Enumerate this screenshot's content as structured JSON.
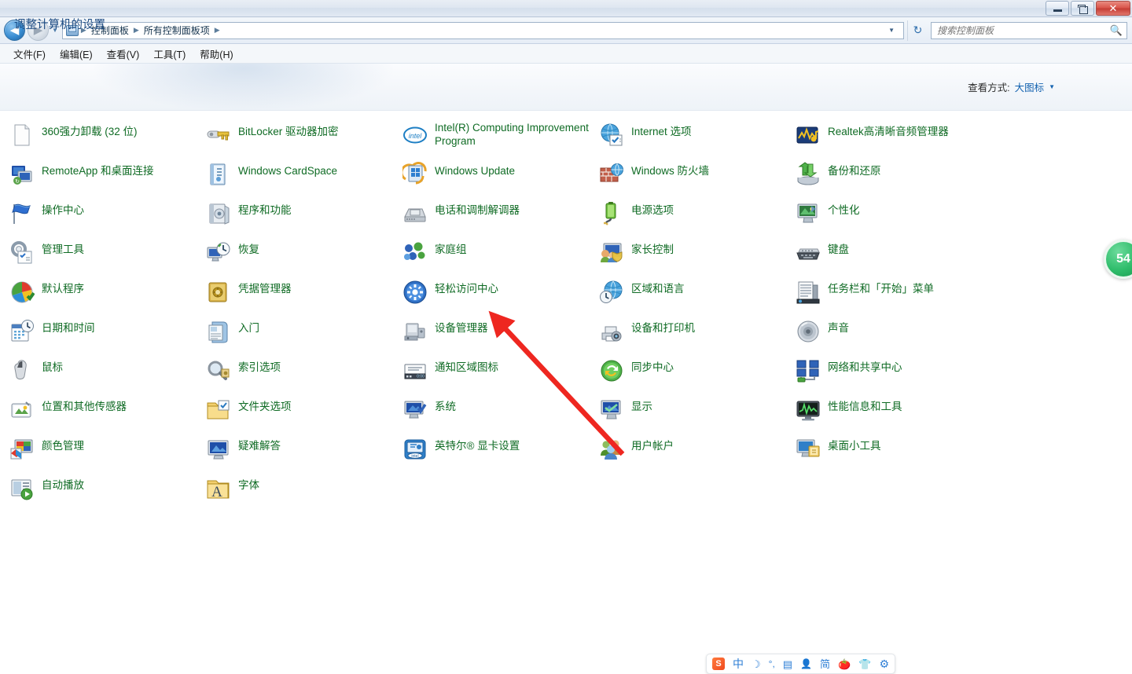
{
  "window": {
    "minimize_label": "最小化",
    "maximize_label": "还原",
    "close_label": "✕"
  },
  "nav": {
    "back_glyph": "◀",
    "forward_glyph": "▶",
    "history_caret": "▼",
    "breadcrumbs": [
      "控制面板",
      "所有控制面板项"
    ],
    "separator": "▶",
    "address_dropdown_caret": "▼",
    "refresh_glyph": "↻"
  },
  "search": {
    "placeholder": "搜索控制面板",
    "value": "",
    "icon": "search-icon"
  },
  "menu": {
    "items": [
      {
        "label": "文件(F)"
      },
      {
        "label": "编辑(E)"
      },
      {
        "label": "查看(V)"
      },
      {
        "label": "工具(T)"
      },
      {
        "label": "帮助(H)"
      }
    ]
  },
  "header": {
    "page_title": "调整计算机的设置",
    "view_mode_label": "查看方式:",
    "view_mode_value": "大图标",
    "view_mode_caret": "▼"
  },
  "columns": [
    {
      "items": [
        {
          "label": "360强力卸载 (32 位)",
          "icon": "blank-page-icon"
        },
        {
          "label": "RemoteApp 和桌面连接",
          "icon": "remote-desktop-icon"
        },
        {
          "label": "操作中心",
          "icon": "flag-icon"
        },
        {
          "label": "管理工具",
          "icon": "admin-tools-icon"
        },
        {
          "label": "默认程序",
          "icon": "default-programs-icon"
        },
        {
          "label": "日期和时间",
          "icon": "date-time-icon"
        },
        {
          "label": "鼠标",
          "icon": "mouse-icon"
        },
        {
          "label": "位置和其他传感器",
          "icon": "location-sensor-icon"
        },
        {
          "label": "颜色管理",
          "icon": "color-management-icon"
        },
        {
          "label": "自动播放",
          "icon": "autoplay-icon"
        }
      ]
    },
    {
      "items": [
        {
          "label": "BitLocker 驱动器加密",
          "icon": "bitlocker-key-icon"
        },
        {
          "label": "Windows CardSpace",
          "icon": "cardspace-icon"
        },
        {
          "label": "程序和功能",
          "icon": "programs-features-icon"
        },
        {
          "label": "恢复",
          "icon": "recovery-icon"
        },
        {
          "label": "凭据管理器",
          "icon": "credential-manager-icon"
        },
        {
          "label": "入门",
          "icon": "getting-started-icon"
        },
        {
          "label": "索引选项",
          "icon": "indexing-options-icon"
        },
        {
          "label": "文件夹选项",
          "icon": "folder-options-icon"
        },
        {
          "label": "疑难解答",
          "icon": "troubleshooting-icon"
        },
        {
          "label": "字体",
          "icon": "fonts-icon"
        }
      ]
    },
    {
      "items": [
        {
          "label": "Intel(R) Computing Improvement Program",
          "icon": "intel-icon",
          "tall": true
        },
        {
          "label": "Windows Update",
          "icon": "windows-update-icon"
        },
        {
          "label": "电话和调制解调器",
          "icon": "phone-modem-icon"
        },
        {
          "label": "家庭组",
          "icon": "homegroup-icon"
        },
        {
          "label": "轻松访问中心",
          "icon": "ease-of-access-icon"
        },
        {
          "label": "设备管理器",
          "icon": "device-manager-icon"
        },
        {
          "label": "通知区域图标",
          "icon": "notification-icons-icon"
        },
        {
          "label": "系统",
          "icon": "system-icon"
        },
        {
          "label": "英特尔® 显卡设置",
          "icon": "intel-graphics-icon"
        }
      ]
    },
    {
      "items": [
        {
          "label": "Internet 选项",
          "icon": "internet-options-icon"
        },
        {
          "label": "Windows 防火墙",
          "icon": "firewall-icon"
        },
        {
          "label": "电源选项",
          "icon": "power-options-icon"
        },
        {
          "label": "家长控制",
          "icon": "parental-controls-icon"
        },
        {
          "label": "区域和语言",
          "icon": "region-language-icon"
        },
        {
          "label": "设备和打印机",
          "icon": "devices-printers-icon"
        },
        {
          "label": "同步中心",
          "icon": "sync-center-icon"
        },
        {
          "label": "显示",
          "icon": "display-icon"
        },
        {
          "label": "用户帐户",
          "icon": "user-accounts-icon"
        }
      ]
    },
    {
      "items": [
        {
          "label": "Realtek高清晰音频管理器",
          "icon": "realtek-audio-icon"
        },
        {
          "label": "备份和还原",
          "icon": "backup-restore-icon"
        },
        {
          "label": "个性化",
          "icon": "personalization-icon"
        },
        {
          "label": "键盘",
          "icon": "keyboard-icon"
        },
        {
          "label": "任务栏和「开始」菜单",
          "icon": "taskbar-startmenu-icon"
        },
        {
          "label": "声音",
          "icon": "sound-icon"
        },
        {
          "label": "网络和共享中心",
          "icon": "network-sharing-icon"
        },
        {
          "label": "性能信息和工具",
          "icon": "performance-tools-icon"
        },
        {
          "label": "桌面小工具",
          "icon": "desktop-gadgets-icon"
        }
      ]
    }
  ],
  "annotation": {
    "type": "arrow",
    "color": "#ee2720",
    "from_label": "用户帐户",
    "to_label": "轻松访问中心"
  },
  "edge_badge": {
    "text": "54",
    "color": "#2fbd6b"
  },
  "ime_bar": {
    "items": [
      {
        "name": "sogou-logo-icon",
        "glyph": "",
        "cls": "ime-logo"
      },
      {
        "name": "chinese-mode-icon",
        "glyph": "中",
        "cls": "ime-zh"
      },
      {
        "name": "moon-icon",
        "glyph": "☽",
        "cls": "ime-moon"
      },
      {
        "name": "punctuation-icon",
        "glyph": "°,",
        "cls": "ime-punct"
      },
      {
        "name": "soft-keyboard-icon",
        "glyph": "▤",
        "cls": "ime-kbd"
      },
      {
        "name": "user-icon",
        "glyph": "👤",
        "cls": "ime-person"
      },
      {
        "name": "simplified-chinese-icon",
        "glyph": "简",
        "cls": "ime-jian"
      },
      {
        "name": "tomato-timer-icon",
        "glyph": "🍅",
        "cls": "ime-tomato"
      },
      {
        "name": "skin-icon",
        "glyph": "👕",
        "cls": "ime-shirt"
      },
      {
        "name": "settings-gear-icon",
        "glyph": "⚙",
        "cls": "ime-gear"
      }
    ]
  },
  "colors": {
    "link_green": "#0f6b24",
    "title_blue": "#1b4a82",
    "accent_blue": "#1563b0",
    "annotation_red": "#ee2720"
  }
}
